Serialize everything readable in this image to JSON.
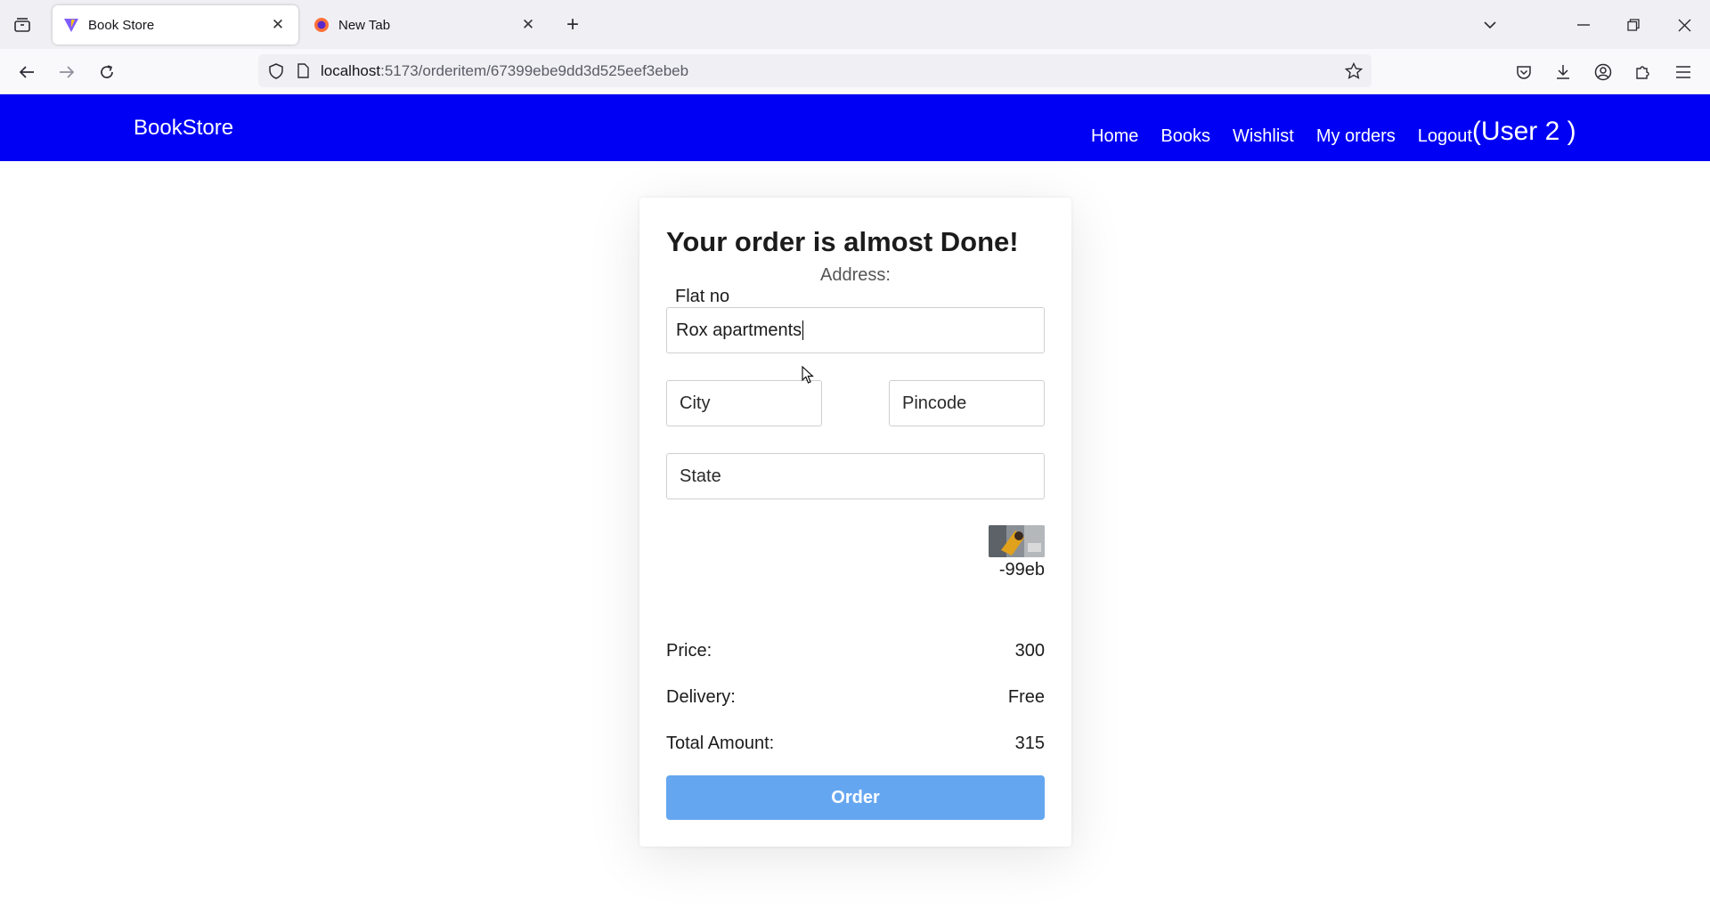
{
  "browser": {
    "tabs": [
      {
        "title": "Book Store",
        "active": true
      },
      {
        "title": "New Tab",
        "active": false
      }
    ],
    "url": {
      "host": "localhost",
      "path": ":5173/orderitem/67399ebe9dd3d525eef3ebeb"
    }
  },
  "navbar": {
    "brand": "BookStore",
    "links": {
      "home": "Home",
      "books": "Books",
      "wishlist": "Wishlist",
      "orders": "My orders",
      "logout": "Logout"
    },
    "user": "(User 2 )"
  },
  "order": {
    "heading": "Your order is almost Done!",
    "address_label": "Address:",
    "flat": {
      "label": "Flat no",
      "value": "Rox apartments"
    },
    "city": {
      "placeholder": "City"
    },
    "pincode": {
      "placeholder": "Pincode"
    },
    "state": {
      "placeholder": "State"
    },
    "item_id": "-99eb",
    "price": {
      "label": "Price:",
      "value": "300"
    },
    "delivery": {
      "label": "Delivery:",
      "value": "Free"
    },
    "total": {
      "label": "Total Amount:",
      "value": "315"
    },
    "order_button": "Order"
  },
  "colors": {
    "navbar": "#0000f5",
    "order_button": "#65a6f1"
  }
}
